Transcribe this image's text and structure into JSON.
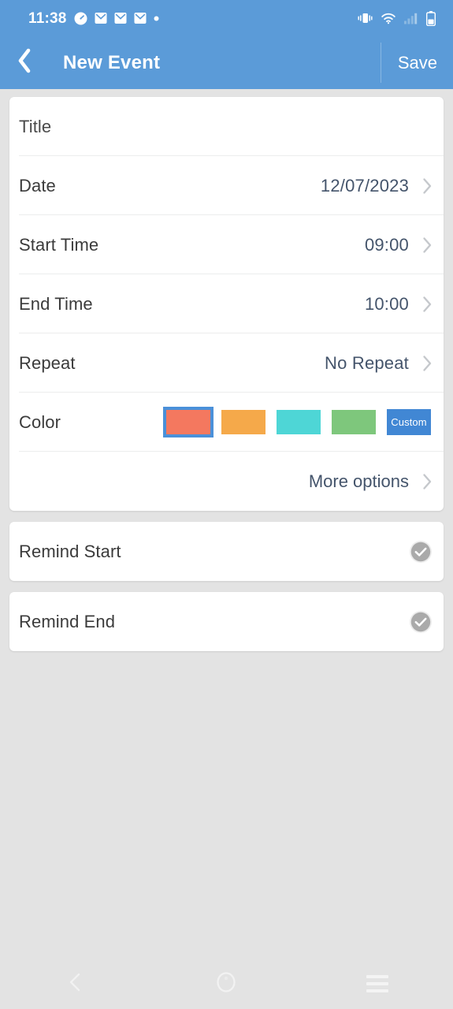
{
  "status_bar": {
    "time": "11:38",
    "left_icons": [
      "clock-icon",
      "mail-icon",
      "mail-icon",
      "mail-icon",
      "dot-icon"
    ],
    "right_icons": [
      "vibrate-icon",
      "wifi-icon",
      "signal-icon",
      "battery-icon"
    ],
    "background_color": "#5b9bd8"
  },
  "app_bar": {
    "back_icon": "back-chevron-icon",
    "title": "New Event",
    "save_label": "Save",
    "background_color": "#5b9bd8"
  },
  "form": {
    "rows": [
      {
        "label": "Title",
        "value": "",
        "chevron": false,
        "is_placeholder": true
      },
      {
        "label": "Date",
        "value": "12/07/2023",
        "chevron": true
      },
      {
        "label": "Start Time",
        "value": "09:00",
        "chevron": true
      },
      {
        "label": "End Time",
        "value": "10:00",
        "chevron": true
      },
      {
        "label": "Repeat",
        "value": "No Repeat",
        "chevron": true
      }
    ],
    "color_row": {
      "label": "Color",
      "swatches": [
        {
          "name": "color-swatch-coral",
          "color": "#f4785f",
          "selected": true
        },
        {
          "name": "color-swatch-orange",
          "color": "#f5a94a",
          "selected": false
        },
        {
          "name": "color-swatch-turquoise",
          "color": "#4ed6d6",
          "selected": false
        },
        {
          "name": "color-swatch-green",
          "color": "#7ec77c",
          "selected": false
        }
      ],
      "custom_label": "Custom",
      "custom_color": "#4187d4",
      "selection_color": "#4a90d9"
    },
    "more_options": {
      "label": "More options",
      "chevron": true
    }
  },
  "reminders": [
    {
      "label": "Remind Start",
      "toggle_icon": "check-circle-icon",
      "toggle_color": "#aaaaaa"
    },
    {
      "label": "Remind End",
      "toggle_icon": "check-circle-icon",
      "toggle_color": "#aaaaaa"
    }
  ],
  "nav_bar": {
    "back_icon": "nav-back-icon",
    "home_icon": "nav-home-icon",
    "recents_icon": "nav-recents-icon"
  }
}
